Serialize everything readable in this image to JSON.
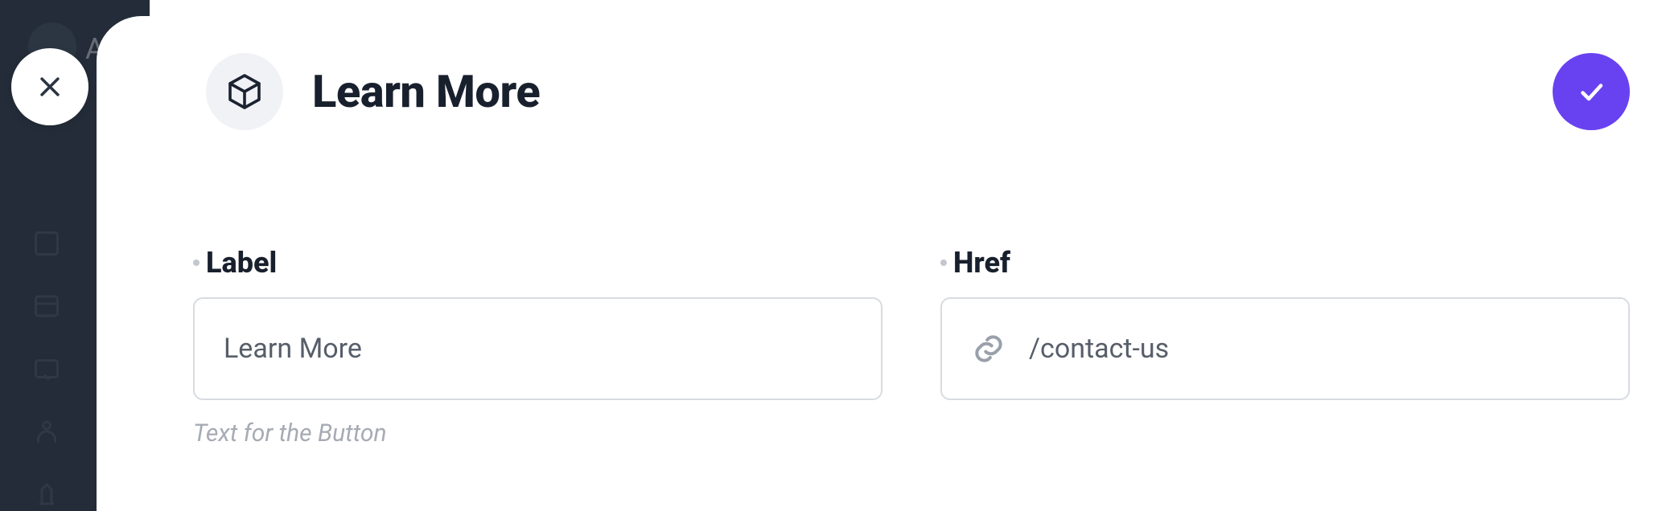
{
  "header": {
    "title": "Learn More"
  },
  "form": {
    "label_field": {
      "label": "Label",
      "value": "Learn More",
      "help": "Text for the Button"
    },
    "href_field": {
      "label": "Href",
      "value": "/contact-us"
    }
  }
}
